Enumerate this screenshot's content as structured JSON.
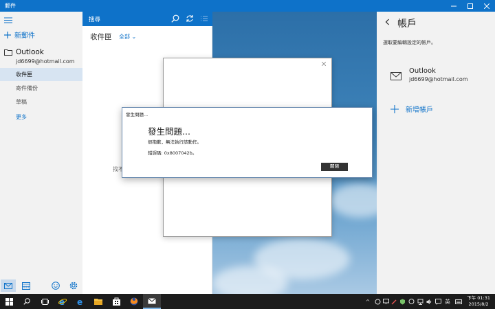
{
  "window": {
    "title": "郵件"
  },
  "nav": {
    "new_mail": "新郵件",
    "account_name": "Outlook",
    "account_email": "jd6699@hotmail.com",
    "folders": [
      "收件匣",
      "寄件備份",
      "草稿"
    ],
    "more": "更多"
  },
  "list": {
    "search_label": "搜尋",
    "inbox_title": "收件匣",
    "filter": "全部",
    "empty_text": "找不"
  },
  "accounts": {
    "title": "帳戶",
    "hint": "選取要編輯設定的帳戶。",
    "account_name": "Outlook",
    "account_email": "jd6699@hotmail.com",
    "add_account": "新增帳戶"
  },
  "error_dialog": {
    "caption": "發生問題...",
    "heading": "發生問題...",
    "message": "很抱歉，無法執行該動作。",
    "code": "錯誤碼: 0x8007042b。",
    "close_button": "關閉"
  },
  "taskbar": {
    "clock_time": "下午 01:31",
    "clock_date": "2015/8/2",
    "ime": "英"
  },
  "colors": {
    "accent": "#0e72c9",
    "taskbar": "#1c1c1c"
  }
}
